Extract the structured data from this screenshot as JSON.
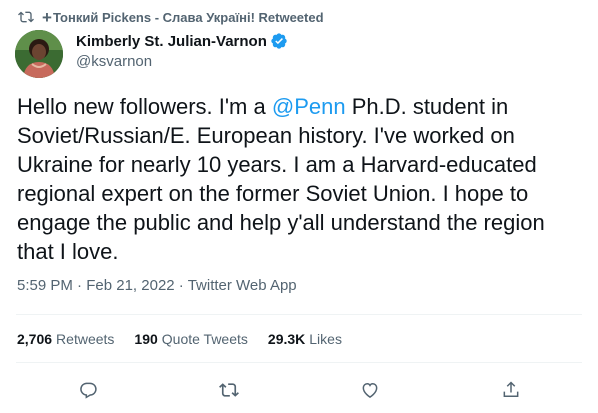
{
  "retweet_context": {
    "plus": "+",
    "text": "Тонкий Pickens - Слава Україні! Retweeted",
    "icon": "retweet-icon"
  },
  "author": {
    "name": "Kimberly St. Julian-Varnon",
    "handle": "@ksvarnon",
    "verified": true,
    "avatar_icon": "avatar-photo"
  },
  "tweet": {
    "text_before": "Hello new followers. I'm a ",
    "mention": "@Penn",
    "text_after": " Ph.D. student in Soviet/Russian/E. European history. I've worked on Ukraine for nearly 10 years. I am a Harvard-educated regional expert on the former Soviet Union. I hope to engage the public and help y'all understand the region that I love."
  },
  "meta": {
    "time": "5:59 PM",
    "sep1": " · ",
    "date": "Feb 21, 2022",
    "sep2": " · ",
    "source": "Twitter Web App"
  },
  "stats": {
    "retweets": {
      "count": "2,706",
      "label": "Retweets"
    },
    "quotes": {
      "count": "190",
      "label": "Quote Tweets"
    },
    "likes": {
      "count": "29.3K",
      "label": "Likes"
    }
  },
  "actions": {
    "reply_icon": "reply-icon",
    "retweet_icon": "retweet-icon",
    "like_icon": "heart-icon",
    "share_icon": "share-icon"
  },
  "colors": {
    "accent": "#1d9bf0",
    "secondary_text": "#536471",
    "divider": "#eff3f4"
  }
}
